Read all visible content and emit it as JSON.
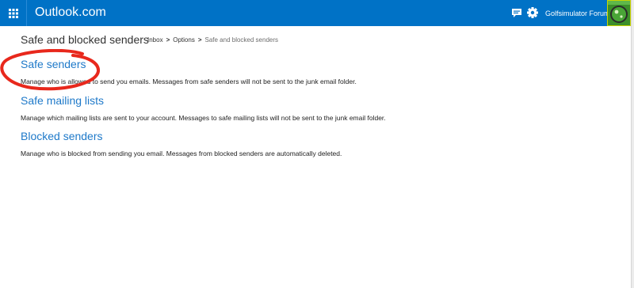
{
  "header": {
    "brand": "Outlook.com",
    "user_name": "Golfsimulator Forum",
    "background_color": "#0072c6",
    "icons": [
      "app-launcher-icon",
      "chat-icon",
      "gear-icon",
      "avatar"
    ]
  },
  "page": {
    "title": "Safe and blocked senders",
    "breadcrumb": {
      "items": [
        "Inbox",
        "Options"
      ],
      "separator": ">",
      "current": "Safe and blocked senders"
    }
  },
  "sections": [
    {
      "title": "Safe senders",
      "description": "Manage who is allowed to send you emails. Messages from safe senders will not be sent to the junk email folder."
    },
    {
      "title": "Safe mailing lists",
      "description": "Manage which mailing lists are sent to your account. Messages to safe mailing lists will not be sent to the junk email folder."
    },
    {
      "title": "Blocked senders",
      "description": "Manage who is blocked from sending you email. Messages from blocked senders are automatically deleted."
    }
  ],
  "annotation": {
    "shape": "ellipse",
    "color": "#e8281c",
    "target": "Safe senders"
  },
  "colors": {
    "link": "#1e79c9",
    "text": "#222222"
  }
}
